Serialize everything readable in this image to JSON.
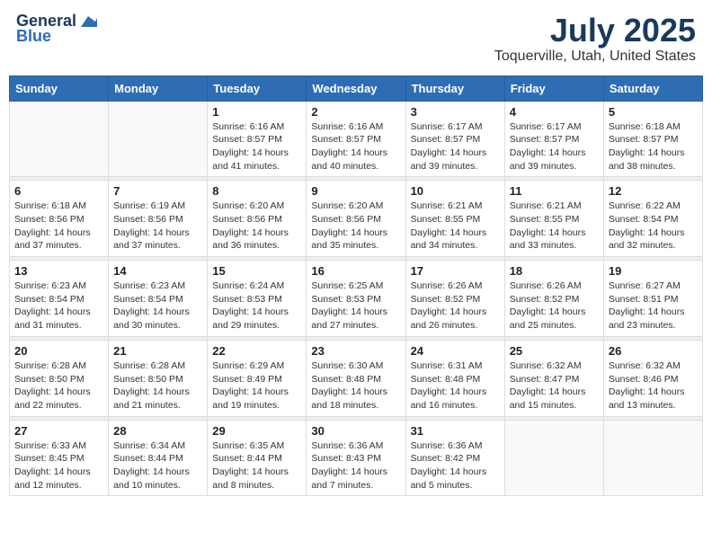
{
  "logo": {
    "line1": "General",
    "line2": "Blue"
  },
  "title": "July 2025",
  "subtitle": "Toquerville, Utah, United States",
  "weekdays": [
    "Sunday",
    "Monday",
    "Tuesday",
    "Wednesday",
    "Thursday",
    "Friday",
    "Saturday"
  ],
  "weeks": [
    [
      {
        "day": "",
        "info": ""
      },
      {
        "day": "",
        "info": ""
      },
      {
        "day": "1",
        "info": "Sunrise: 6:16 AM\nSunset: 8:57 PM\nDaylight: 14 hours\nand 41 minutes."
      },
      {
        "day": "2",
        "info": "Sunrise: 6:16 AM\nSunset: 8:57 PM\nDaylight: 14 hours\nand 40 minutes."
      },
      {
        "day": "3",
        "info": "Sunrise: 6:17 AM\nSunset: 8:57 PM\nDaylight: 14 hours\nand 39 minutes."
      },
      {
        "day": "4",
        "info": "Sunrise: 6:17 AM\nSunset: 8:57 PM\nDaylight: 14 hours\nand 39 minutes."
      },
      {
        "day": "5",
        "info": "Sunrise: 6:18 AM\nSunset: 8:57 PM\nDaylight: 14 hours\nand 38 minutes."
      }
    ],
    [
      {
        "day": "6",
        "info": "Sunrise: 6:18 AM\nSunset: 8:56 PM\nDaylight: 14 hours\nand 37 minutes."
      },
      {
        "day": "7",
        "info": "Sunrise: 6:19 AM\nSunset: 8:56 PM\nDaylight: 14 hours\nand 37 minutes."
      },
      {
        "day": "8",
        "info": "Sunrise: 6:20 AM\nSunset: 8:56 PM\nDaylight: 14 hours\nand 36 minutes."
      },
      {
        "day": "9",
        "info": "Sunrise: 6:20 AM\nSunset: 8:56 PM\nDaylight: 14 hours\nand 35 minutes."
      },
      {
        "day": "10",
        "info": "Sunrise: 6:21 AM\nSunset: 8:55 PM\nDaylight: 14 hours\nand 34 minutes."
      },
      {
        "day": "11",
        "info": "Sunrise: 6:21 AM\nSunset: 8:55 PM\nDaylight: 14 hours\nand 33 minutes."
      },
      {
        "day": "12",
        "info": "Sunrise: 6:22 AM\nSunset: 8:54 PM\nDaylight: 14 hours\nand 32 minutes."
      }
    ],
    [
      {
        "day": "13",
        "info": "Sunrise: 6:23 AM\nSunset: 8:54 PM\nDaylight: 14 hours\nand 31 minutes."
      },
      {
        "day": "14",
        "info": "Sunrise: 6:23 AM\nSunset: 8:54 PM\nDaylight: 14 hours\nand 30 minutes."
      },
      {
        "day": "15",
        "info": "Sunrise: 6:24 AM\nSunset: 8:53 PM\nDaylight: 14 hours\nand 29 minutes."
      },
      {
        "day": "16",
        "info": "Sunrise: 6:25 AM\nSunset: 8:53 PM\nDaylight: 14 hours\nand 27 minutes."
      },
      {
        "day": "17",
        "info": "Sunrise: 6:26 AM\nSunset: 8:52 PM\nDaylight: 14 hours\nand 26 minutes."
      },
      {
        "day": "18",
        "info": "Sunrise: 6:26 AM\nSunset: 8:52 PM\nDaylight: 14 hours\nand 25 minutes."
      },
      {
        "day": "19",
        "info": "Sunrise: 6:27 AM\nSunset: 8:51 PM\nDaylight: 14 hours\nand 23 minutes."
      }
    ],
    [
      {
        "day": "20",
        "info": "Sunrise: 6:28 AM\nSunset: 8:50 PM\nDaylight: 14 hours\nand 22 minutes."
      },
      {
        "day": "21",
        "info": "Sunrise: 6:28 AM\nSunset: 8:50 PM\nDaylight: 14 hours\nand 21 minutes."
      },
      {
        "day": "22",
        "info": "Sunrise: 6:29 AM\nSunset: 8:49 PM\nDaylight: 14 hours\nand 19 minutes."
      },
      {
        "day": "23",
        "info": "Sunrise: 6:30 AM\nSunset: 8:48 PM\nDaylight: 14 hours\nand 18 minutes."
      },
      {
        "day": "24",
        "info": "Sunrise: 6:31 AM\nSunset: 8:48 PM\nDaylight: 14 hours\nand 16 minutes."
      },
      {
        "day": "25",
        "info": "Sunrise: 6:32 AM\nSunset: 8:47 PM\nDaylight: 14 hours\nand 15 minutes."
      },
      {
        "day": "26",
        "info": "Sunrise: 6:32 AM\nSunset: 8:46 PM\nDaylight: 14 hours\nand 13 minutes."
      }
    ],
    [
      {
        "day": "27",
        "info": "Sunrise: 6:33 AM\nSunset: 8:45 PM\nDaylight: 14 hours\nand 12 minutes."
      },
      {
        "day": "28",
        "info": "Sunrise: 6:34 AM\nSunset: 8:44 PM\nDaylight: 14 hours\nand 10 minutes."
      },
      {
        "day": "29",
        "info": "Sunrise: 6:35 AM\nSunset: 8:44 PM\nDaylight: 14 hours\nand 8 minutes."
      },
      {
        "day": "30",
        "info": "Sunrise: 6:36 AM\nSunset: 8:43 PM\nDaylight: 14 hours\nand 7 minutes."
      },
      {
        "day": "31",
        "info": "Sunrise: 6:36 AM\nSunset: 8:42 PM\nDaylight: 14 hours\nand 5 minutes."
      },
      {
        "day": "",
        "info": ""
      },
      {
        "day": "",
        "info": ""
      }
    ]
  ]
}
